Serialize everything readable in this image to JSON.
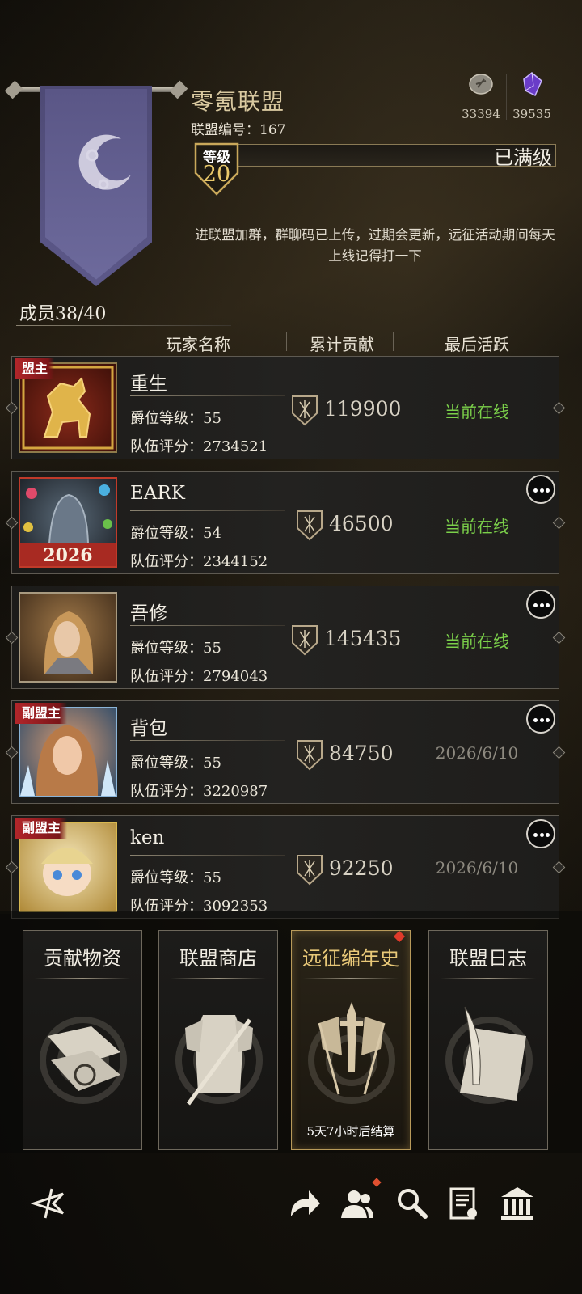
{
  "header": {
    "alliance_name": "零氪联盟",
    "alliance_id": "联盟编号：167",
    "level_label": "等级",
    "level": "20",
    "level_status": "已满级",
    "currency": [
      {
        "icon": "stone-coin-icon",
        "value": "33394"
      },
      {
        "icon": "purple-crystal-icon",
        "value": "39535"
      }
    ],
    "notice": "进联盟加群，群聊码已上传，过期会更新，远征活动期间每天上线记得打一下"
  },
  "members": {
    "count": "成员38/40",
    "columns": [
      "玩家名称",
      "累计贡献",
      "最后活跃"
    ],
    "rows": [
      {
        "role": "盟主",
        "name": "重生",
        "rank": "爵位等级：55",
        "score": "队伍评分：2734521",
        "contribution": "119900",
        "last_active": "当前在线",
        "online": true,
        "has_more": false
      },
      {
        "role": "",
        "name": "EARK",
        "rank": "爵位等级：54",
        "score": "队伍评分：2344152",
        "contribution": "46500",
        "last_active": "当前在线",
        "online": true,
        "has_more": true,
        "avatar_text": "2026"
      },
      {
        "role": "",
        "name": "吾修",
        "rank": "爵位等级：55",
        "score": "队伍评分：2794043",
        "contribution": "145435",
        "last_active": "当前在线",
        "online": true,
        "has_more": true
      },
      {
        "role": "副盟主",
        "name": "背包",
        "rank": "爵位等级：55",
        "score": "队伍评分：3220987",
        "contribution": "84750",
        "last_active": "2026/6/10",
        "online": false,
        "has_more": true
      },
      {
        "role": "副盟主",
        "name": "ken",
        "rank": "爵位等级：55",
        "score": "队伍评分：3092353",
        "contribution": "92250",
        "last_active": "2026/6/10",
        "online": false,
        "has_more": true
      }
    ]
  },
  "cards": [
    {
      "title": "贡献物资",
      "icon": "supply-scroll-icon"
    },
    {
      "title": "联盟商店",
      "icon": "armor-shop-icon"
    },
    {
      "title": "远征编年史",
      "icon": "sword-banners-icon",
      "timer": "5天7小时后结算",
      "active": true
    },
    {
      "title": "联盟日志",
      "icon": "quill-log-icon"
    }
  ],
  "nav": [
    "back-icon",
    "share-icon",
    "members-icon",
    "search-icon",
    "document-icon",
    "hall-icon"
  ],
  "colors": {
    "online": "#7bd04a",
    "gold": "#e8c86a",
    "leader_tag": "#b2262a"
  }
}
